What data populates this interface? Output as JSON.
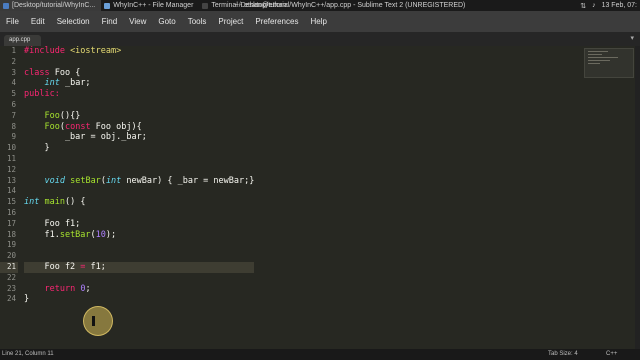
{
  "taskbar": {
    "tasks": [
      {
        "label": "[Desktop/tutorial/WhyInC...",
        "color": "#4a7cc2"
      },
      {
        "label": "WhyInC++ - File Manager",
        "color": "#6a9fd8"
      },
      {
        "label": "Terminal - ethan@ethan:",
        "color": "#444"
      }
    ],
    "window_title": "~/Desktop/tutorial/WhyInC++/app.cpp - Sublime Text 2 (UNREGISTERED)",
    "clock": "13 Feb, 07:"
  },
  "menu": [
    "File",
    "Edit",
    "Selection",
    "Find",
    "View",
    "Goto",
    "Tools",
    "Project",
    "Preferences",
    "Help"
  ],
  "tab": {
    "label": "app.cpp",
    "menu_symbol": "▾"
  },
  "editor": {
    "line_numbers": [
      "1",
      "2",
      "3",
      "4",
      "5",
      "6",
      "7",
      "8",
      "9",
      "10",
      "11",
      "12",
      "13",
      "14",
      "15",
      "16",
      "17",
      "18",
      "19",
      "20",
      "21",
      "22",
      "23",
      "24"
    ],
    "current_line": "21",
    "lines": [
      [
        {
          "t": "#include <iostream>",
          "c": "pp"
        }
      ],
      [],
      [
        {
          "t": "class ",
          "c": "kw"
        },
        {
          "t": "Foo",
          "c": ""
        },
        {
          "t": " {",
          "c": ""
        }
      ],
      [
        {
          "t": "    ",
          "c": ""
        },
        {
          "t": "int",
          "c": "ty"
        },
        {
          "t": " _bar;",
          "c": ""
        }
      ],
      [
        {
          "t": "public:",
          "c": "kw"
        }
      ],
      [],
      [
        {
          "t": "    ",
          "c": ""
        },
        {
          "t": "Foo",
          "c": "fn"
        },
        {
          "t": "(){}",
          "c": ""
        }
      ],
      [
        {
          "t": "    ",
          "c": ""
        },
        {
          "t": "Foo",
          "c": "fn"
        },
        {
          "t": "(",
          "c": ""
        },
        {
          "t": "const",
          "c": "kw"
        },
        {
          "t": " Foo obj){",
          "c": ""
        }
      ],
      [
        {
          "t": "        _bar = obj._bar;",
          "c": ""
        }
      ],
      [
        {
          "t": "    }",
          "c": ""
        }
      ],
      [],
      [],
      [
        {
          "t": "    ",
          "c": ""
        },
        {
          "t": "void",
          "c": "ty"
        },
        {
          "t": " ",
          "c": ""
        },
        {
          "t": "setBar",
          "c": "fn"
        },
        {
          "t": "(",
          "c": ""
        },
        {
          "t": "int",
          "c": "ty"
        },
        {
          "t": " newBar) { _bar = newBar;}",
          "c": ""
        }
      ],
      [],
      [
        {
          "t": "int",
          "c": "ty"
        },
        {
          "t": " ",
          "c": ""
        },
        {
          "t": "main",
          "c": "fn"
        },
        {
          "t": "() {",
          "c": ""
        }
      ],
      [],
      [
        {
          "t": "    Foo f1;",
          "c": ""
        }
      ],
      [
        {
          "t": "    f1.",
          "c": ""
        },
        {
          "t": "setBar",
          "c": "cn"
        },
        {
          "t": "(",
          "c": ""
        },
        {
          "t": "10",
          "c": "nm"
        },
        {
          "t": ");",
          "c": ""
        }
      ],
      [],
      [],
      [
        {
          "t": "    Foo f2 ",
          "c": ""
        },
        {
          "t": "=",
          "c": "kw"
        },
        {
          "t": " f1;",
          "c": ""
        }
      ],
      [],
      [
        {
          "t": "    ",
          "c": ""
        },
        {
          "t": "return",
          "c": "kw"
        },
        {
          "t": " ",
          "c": ""
        },
        {
          "t": "0",
          "c": "nm"
        },
        {
          "t": ";",
          "c": ""
        }
      ],
      [
        {
          "t": "}",
          "c": ""
        }
      ]
    ]
  },
  "status": {
    "position": "Line 21, Column 11",
    "tab_size": "Tab Size: 4",
    "syntax": "C++"
  }
}
